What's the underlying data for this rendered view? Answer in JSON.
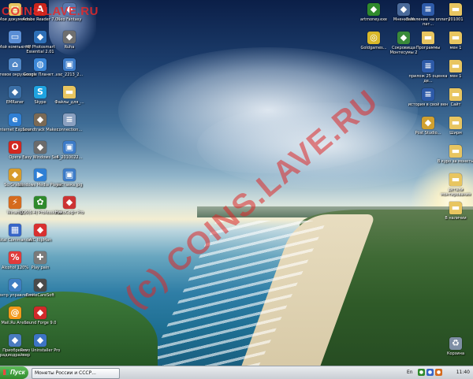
{
  "watermark": {
    "corner_text": "COINS.LAVE.RU",
    "diagonal_text": "(c) COINS.LAVE.RU"
  },
  "desktop": {
    "icons_col1": [
      {
        "label": "Мои документы",
        "icon": "documents-icon",
        "color": "#e8c560"
      },
      {
        "label": "Мой компьютер",
        "icon": "computer-icon",
        "color": "#5a8ed6"
      },
      {
        "label": "Сетевое окружение",
        "icon": "network-icon",
        "color": "#4f86c6"
      },
      {
        "label": "EMRaner",
        "icon": "app-icon",
        "color": "#3a6ea5"
      },
      {
        "label": "Internet Explorer",
        "icon": "internet-explorer-icon",
        "color": "#2f7fd4"
      },
      {
        "label": "Opera",
        "icon": "opera-icon",
        "color": "#d2271f"
      },
      {
        "label": "ScrGrabs...",
        "icon": "app-icon",
        "color": "#d79b2a"
      },
      {
        "label": "Winamp",
        "icon": "winamp-icon",
        "color": "#d56b1e"
      },
      {
        "label": "Total Commander",
        "icon": "total-commander-icon",
        "color": "#3665c7"
      },
      {
        "label": "Alcohol 120%",
        "icon": "alcohol-icon",
        "color": "#e03b3b"
      },
      {
        "label": "Центр управления",
        "icon": "control-center-icon",
        "color": "#3f7ec2"
      },
      {
        "label": "Mail.Ru Агент",
        "icon": "mail-agent-icon",
        "color": "#f39a1b"
      },
      {
        "label": "Приобрести радиодрайвер",
        "icon": "app-icon",
        "color": "#4a7bbf"
      }
    ],
    "icons_col2": [
      {
        "label": "Adobe Reader 7.0",
        "icon": "adobe-reader-icon",
        "color": "#c9261c"
      },
      {
        "label": "HP Photosmart Essential 2.01",
        "icon": "hp-photosmart-icon",
        "color": "#2d6fb7"
      },
      {
        "label": "Google Планет...",
        "icon": "google-earth-icon",
        "color": "#3b86d6"
      },
      {
        "label": "Skype",
        "icon": "skype-icon",
        "color": "#1fa3e0"
      },
      {
        "label": "Soundtrack Maker",
        "icon": "app-icon",
        "color": "#7b6a55"
      },
      {
        "label": "Easy Windows Set",
        "icon": "app-icon",
        "color": "#6b6b6b"
      },
      {
        "label": "Windows Media Player",
        "icon": "media-player-icon",
        "color": "#2f7fd4"
      },
      {
        "label": "ICQ6(6.4) Professional",
        "icon": "icq-icon",
        "color": "#2f8a2c"
      },
      {
        "label": "AIC RipMan",
        "icon": "ripman-icon",
        "color": "#d83030"
      },
      {
        "label": "Play pain",
        "icon": "gamepad-icon",
        "color": "#7a7a7a"
      },
      {
        "label": "EmiteCareSoft",
        "icon": "app-icon",
        "color": "#4a4a4a"
      },
      {
        "label": "Sound Forge 9.0",
        "icon": "sound-forge-icon",
        "color": "#d02a2a"
      },
      {
        "label": "Revo Uninstaller Pro",
        "icon": "revo-uninstaller-icon",
        "color": "#3d74c4"
      }
    ],
    "icons_col3": [
      {
        "label": "Neo Fantasy",
        "icon": "app-icon",
        "color": "#5a7ab0"
      },
      {
        "label": "Ruha",
        "icon": "app-icon",
        "color": "#6f6f6f"
      },
      {
        "label": "vac_2213_2...",
        "icon": "image-file-icon",
        "color": "#3c7bc8"
      },
      {
        "label": "Файлы_для_...",
        "icon": "folder-icon",
        "color": "#e8c560"
      },
      {
        "label": "connection...",
        "icon": "document-file-icon",
        "color": "#8aa0c0"
      },
      {
        "label": "4_2010022...",
        "icon": "image-file-icon",
        "color": "#3c7bc8"
      },
      {
        "label": "заставка.jpg",
        "icon": "image-file-icon",
        "color": "#3c7bc8"
      },
      {
        "label": "НикоСофт Pro",
        "icon": "app-icon",
        "color": "#c33"
      }
    ],
    "icons_right_a": [
      {
        "label": "artmoney.exe",
        "icon": "artmoney-icon",
        "color": "#2f8a2c"
      },
      {
        "label": "Goldgames...",
        "icon": "disc-icon",
        "color": "#d9b82a"
      }
    ],
    "icons_right_b": [
      {
        "label": "Мнения III",
        "icon": "app-icon",
        "color": "#4a6a9a"
      },
      {
        "label": "Сокровища Монтесумы 2",
        "icon": "game-icon",
        "color": "#3a8a3a"
      }
    ],
    "icons_right_c": [
      {
        "label": "Заявление на оплату пат...",
        "icon": "document-file-icon",
        "color": "#2d5aa8"
      },
      {
        "label": "Программы",
        "icon": "folder-icon",
        "color": "#e8c560"
      },
      {
        "label": "прилож 25 оценка де...",
        "icon": "document-file-icon",
        "color": "#2d5aa8"
      },
      {
        "label": "история в свой вен",
        "icon": "document-file-icon",
        "color": "#2d5aa8"
      },
      {
        "label": "Post Studio...",
        "icon": "app-icon",
        "color": "#d0a030"
      }
    ],
    "icons_right_d": [
      {
        "label": "201001",
        "icon": "folder-icon",
        "color": "#e8c560"
      },
      {
        "label": "мен 1",
        "icon": "folder-icon",
        "color": "#e8c560"
      },
      {
        "label": "мен 1",
        "icon": "folder-icon",
        "color": "#e8c560"
      },
      {
        "label": "Сайт",
        "icon": "folder-icon",
        "color": "#e8c560"
      },
      {
        "label": "Ширм",
        "icon": "folder-icon",
        "color": "#e8c560"
      },
      {
        "label": "В куро за монеты",
        "icon": "folder-icon",
        "color": "#e8c560"
      },
      {
        "label": "детали монтирования",
        "icon": "folder-icon",
        "color": "#e8c560"
      },
      {
        "label": "В наличии",
        "icon": "folder-icon",
        "color": "#e8c560"
      }
    ],
    "recycle_bin": {
      "label": "Корзина",
      "icon": "recycle-bin-icon",
      "color": "#7f8fa5"
    }
  },
  "taskbar": {
    "start_label": "Пуск",
    "task_label": "Монеты России и СССР...",
    "tray_lang": "En",
    "clock": "11:40"
  }
}
